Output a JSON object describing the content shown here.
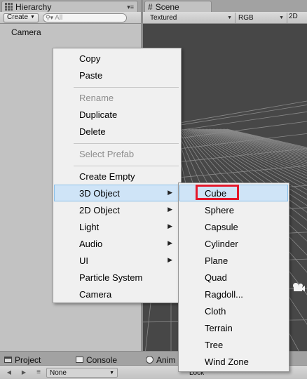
{
  "hierarchy": {
    "tab_title": "Hierarchy",
    "tab_menu_icon": "▾≡",
    "create_label": "Create",
    "search_placeholder": "All",
    "items": [
      "Camera"
    ]
  },
  "scene": {
    "tab_title": "Scene",
    "tab_icon": "#",
    "shading_mode": "Textured",
    "channel_mode": "RGB",
    "mode_2d": "2D",
    "background_color": "#474747",
    "grid_color": "#8a8a8a"
  },
  "bottom": {
    "tabs": [
      "Project",
      "Console",
      "Anim"
    ],
    "clip_value": "None",
    "lock_label": "Lock"
  },
  "context_menu": {
    "items": [
      {
        "label": "Copy",
        "disabled": false
      },
      {
        "label": "Paste",
        "disabled": false
      },
      {
        "label": "Rename",
        "disabled": true
      },
      {
        "label": "Duplicate",
        "disabled": false
      },
      {
        "label": "Delete",
        "disabled": false
      },
      {
        "label": "Select Prefab",
        "disabled": true
      },
      {
        "label": "Create Empty",
        "disabled": false
      },
      {
        "label": "3D Object",
        "disabled": false,
        "submenu": true,
        "active": true
      },
      {
        "label": "2D Object",
        "disabled": false,
        "submenu": true
      },
      {
        "label": "Light",
        "disabled": false,
        "submenu": true
      },
      {
        "label": "Audio",
        "disabled": false,
        "submenu": true
      },
      {
        "label": "UI",
        "disabled": false,
        "submenu": true
      },
      {
        "label": "Particle System",
        "disabled": false
      },
      {
        "label": "Camera",
        "disabled": false
      }
    ],
    "submenu_arrow": "▶"
  },
  "submenu_3d": {
    "items": [
      "Cube",
      "Sphere",
      "Capsule",
      "Cylinder",
      "Plane",
      "Quad",
      "Ragdoll...",
      "Cloth",
      "Terrain",
      "Tree",
      "Wind Zone"
    ],
    "highlighted": "Cube",
    "highlight_color": "#e4172b",
    "hover_color": "#cfe4f7"
  }
}
